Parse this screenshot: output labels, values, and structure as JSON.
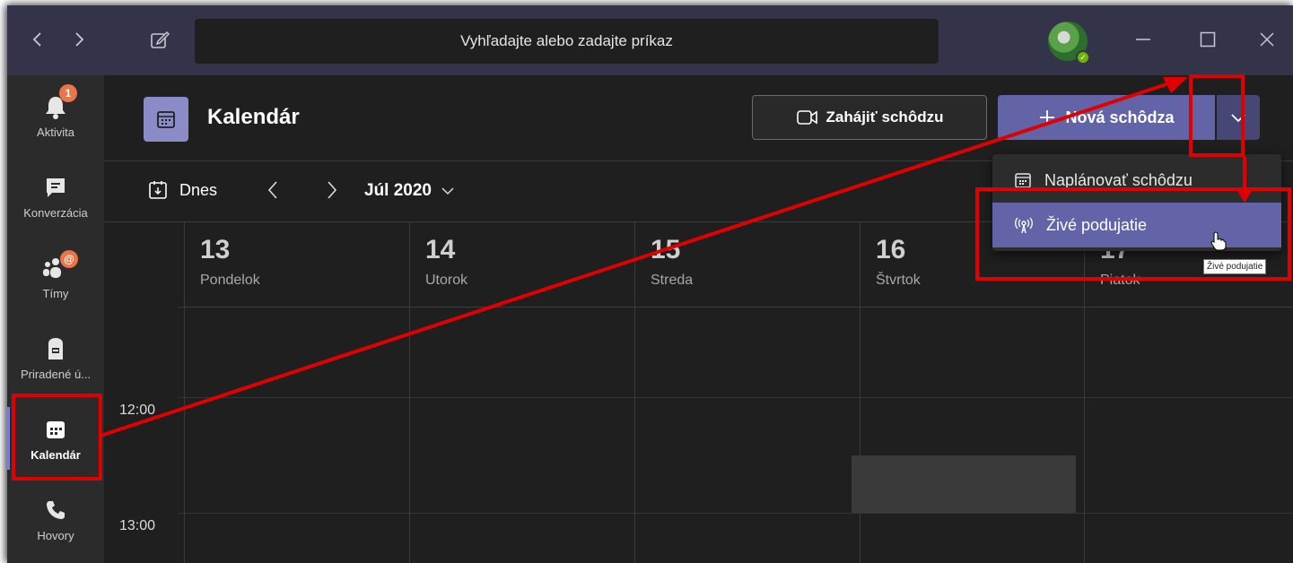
{
  "titlebar": {
    "search_placeholder": "Vyhľadajte alebo zadajte príkaz",
    "back_icon": "chevron-left-icon",
    "forward_icon": "chevron-right-icon",
    "compose_icon": "compose-icon",
    "minimize_icon": "minimize-icon",
    "maximize_icon": "maximize-icon",
    "close_icon": "close-icon"
  },
  "rail": {
    "items": [
      {
        "label": "Aktivita",
        "icon": "bell-icon",
        "badge": "1"
      },
      {
        "label": "Konverzácia",
        "icon": "chat-icon"
      },
      {
        "label": "Tímy",
        "icon": "teams-icon",
        "badge": "@"
      },
      {
        "label": "Priradené ú...",
        "icon": "assignments-icon"
      },
      {
        "label": "Kalendár",
        "icon": "calendar-icon",
        "active": true
      },
      {
        "label": "Hovory",
        "icon": "phone-icon"
      }
    ]
  },
  "header": {
    "title": "Kalendár",
    "meet_now_label": "Zahájiť schôdzu",
    "new_meeting_label": "Nová schôdza"
  },
  "toolbar": {
    "today_label": "Dnes",
    "month_label": "Júl 2020"
  },
  "days": [
    {
      "num": "13",
      "name": "Pondelok"
    },
    {
      "num": "14",
      "name": "Utorok"
    },
    {
      "num": "15",
      "name": "Streda"
    },
    {
      "num": "16",
      "name": "Štvrtok"
    },
    {
      "num": "17",
      "name": "Piatok"
    }
  ],
  "times": [
    "12:00",
    "13:00"
  ],
  "menu": {
    "items": [
      {
        "label": "Naplánovať schôdzu",
        "icon": "calendar-icon"
      },
      {
        "label": "Živé podujatie",
        "icon": "broadcast-icon",
        "hover": true
      }
    ],
    "tooltip": "Živé podujatie"
  },
  "colors": {
    "accent": "#6264a7",
    "annotation": "#e00000",
    "titlebar": "#33344a",
    "background": "#1f1f1f"
  }
}
